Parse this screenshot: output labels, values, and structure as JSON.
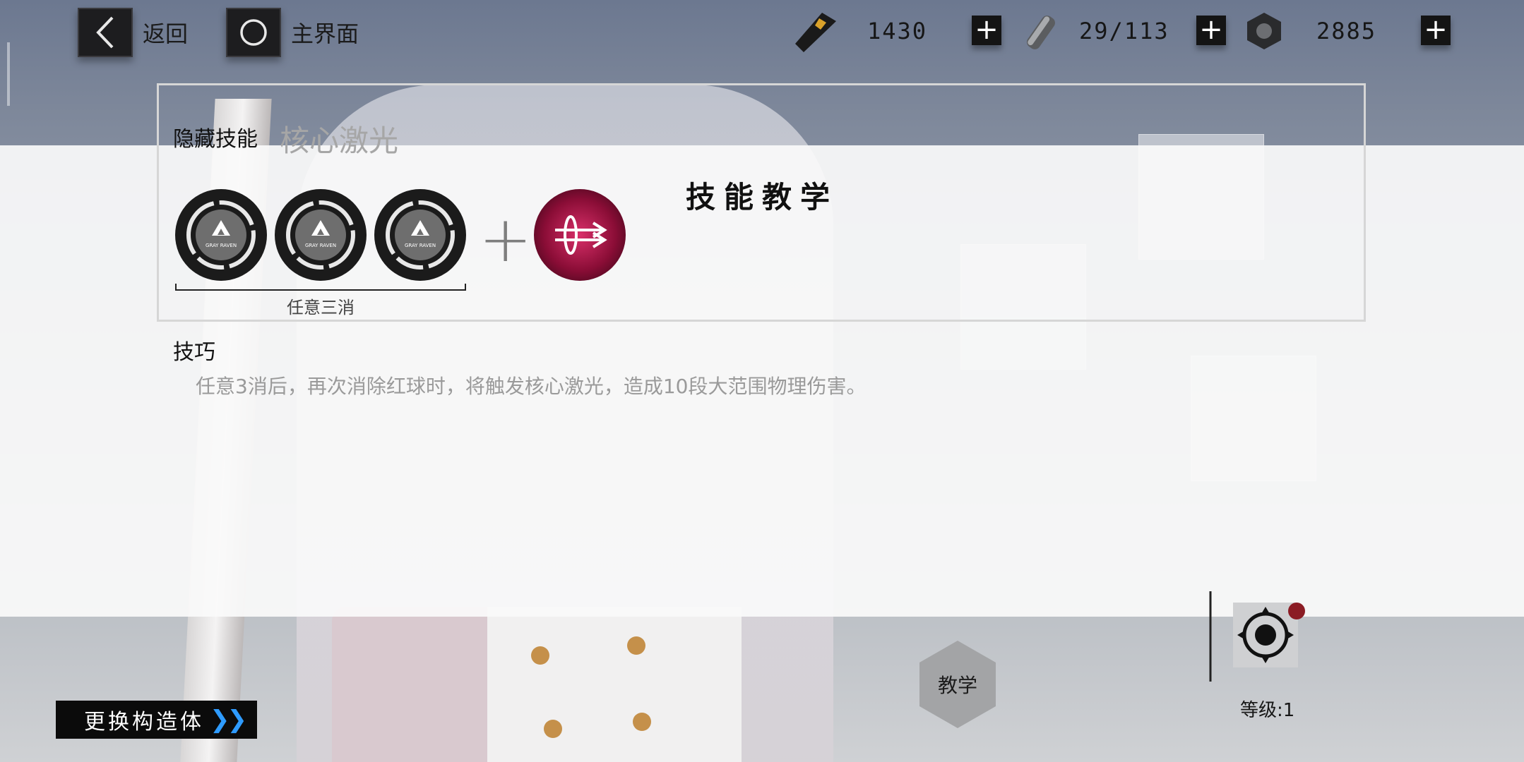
{
  "topbar": {
    "back_label": "返回",
    "home_label": "主界面",
    "resources": [
      {
        "icon": "card-icon",
        "value": "1430"
      },
      {
        "icon": "battery-icon",
        "value": "29/113"
      },
      {
        "icon": "hex-nut-icon",
        "value": "2885"
      }
    ]
  },
  "modal": {
    "title": "技能教学",
    "hidden_skill_label": "隐藏技能",
    "skill_name": "核心激光",
    "orb_label": "GRAY RAVEN",
    "bracket_label": "任意三消",
    "tips_title": "技巧",
    "tips_text": "任意3消后，再次消除红球时，将触发核心激光，造成10段大范围物理伤害。"
  },
  "bottom": {
    "switch_button_label": "更换构造体",
    "teach_button_label": "教学",
    "level_label": "等级:1"
  },
  "colors": {
    "accent_blue": "#2e9bff",
    "red_orb": "#c0134a"
  }
}
